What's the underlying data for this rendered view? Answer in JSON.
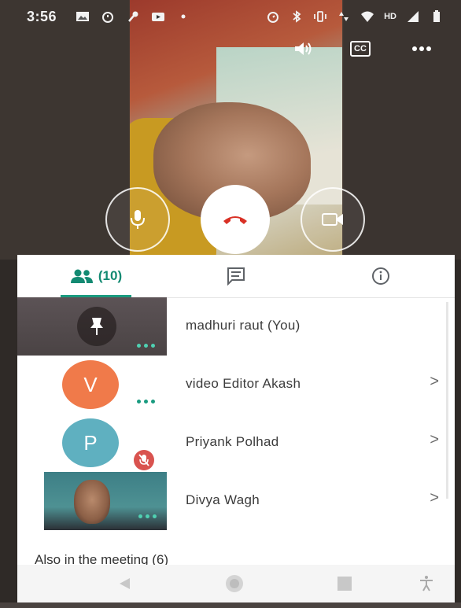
{
  "status_bar": {
    "time": "3:56",
    "left_icons": [
      "image-icon",
      "alarm-icon",
      "pin-icon",
      "youtube-icon",
      "dot-icon"
    ],
    "right_icons": [
      "alarm-icon",
      "bluetooth-icon",
      "vibrate-icon",
      "data-icon",
      "wifi-icon",
      "hd-icon",
      "signal-icon",
      "battery-icon"
    ],
    "hd_label": "HD"
  },
  "top_controls": {
    "speaker_icon": "volume-icon",
    "captions_label": "CC",
    "more_icon": "more-icon"
  },
  "call_controls": {
    "mic_icon": "mic-icon",
    "end_call_icon": "end-call-icon",
    "camera_icon": "camera-icon"
  },
  "tabs": {
    "people_count": "(10)",
    "people_icon": "people-icon",
    "chat_icon": "chat-icon",
    "info_icon": "info-icon"
  },
  "colors": {
    "accent": "#1a9b80",
    "end_call_red": "#d93025",
    "avatar_v": "#f07a4a",
    "avatar_p": "#5fb0c0",
    "mute_red": "#d9534f"
  },
  "participants": [
    {
      "name": "madhuri raut (You)",
      "thumb": "video",
      "pinned": true
    },
    {
      "name": "video Editor Akash",
      "avatar_letter": "V",
      "chevron": ">"
    },
    {
      "name": "Priyank Polhad",
      "avatar_letter": "P",
      "muted": true,
      "chevron": ">"
    },
    {
      "name": "Divya Wagh",
      "thumb": "video",
      "chevron": ">"
    }
  ],
  "also_in_meeting": "Also in the meeting (6)",
  "nav_bar": [
    "back-icon",
    "home-icon",
    "recents-icon",
    "accessibility-icon"
  ]
}
